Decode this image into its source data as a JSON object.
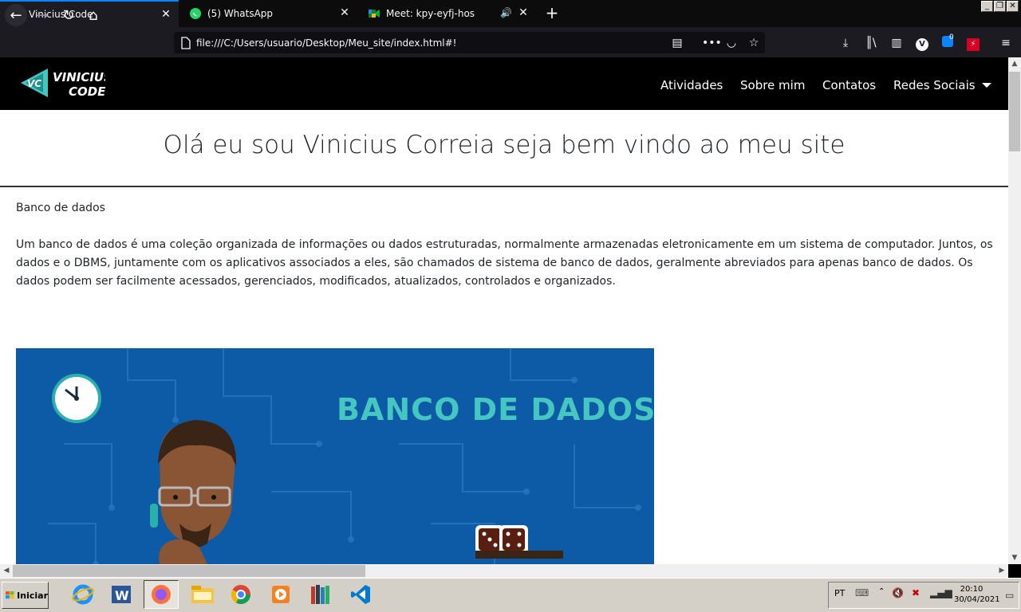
{
  "browser": {
    "tabs": [
      {
        "label": "Vinicius Code",
        "icon": "vc-favicon",
        "active": true
      },
      {
        "label": "(5) WhatsApp",
        "icon": "whatsapp-icon",
        "active": false
      },
      {
        "label": "Meet: kpy-eyfj-hos",
        "icon": "meet-icon",
        "active": false
      }
    ],
    "url": "file:///C:/Users/usuario/Desktop/Meu_site/index.html#!",
    "notification_count": "0",
    "accent": "#0a84ff"
  },
  "site": {
    "logo_text_line1": "VINICIUS",
    "logo_text_line2": "CODE",
    "logo_initials": "VC",
    "nav": [
      "Atividades",
      "Sobre mim",
      "Contatos",
      "Redes Sociais"
    ],
    "hero_title": "Olá eu sou Vinicius Correia seja bem vindo ao meu site",
    "section_heading": "Banco de dados",
    "section_body": "Um banco de dados é uma coleção organizada de informações ou dados estruturadas, normalmente armazenadas eletronicamente em um sistema de computador. Juntos, os dados e o DBMS, juntamente com os aplicativos associados a eles, são chamados de sistema de banco de dados, geralmente abreviados para apenas banco de dados. Os dados podem ser facilmente acessados, gerenciados, modificados, atualizados, controlados e organizados.",
    "banner_title": "BANCO DE DADOS",
    "banner_bg": "#0d5ba6",
    "banner_accent": "#45c6c1"
  },
  "taskbar": {
    "start_label": "Iniciar",
    "language": "PT",
    "time": "20:10",
    "date": "30/04/2021"
  }
}
